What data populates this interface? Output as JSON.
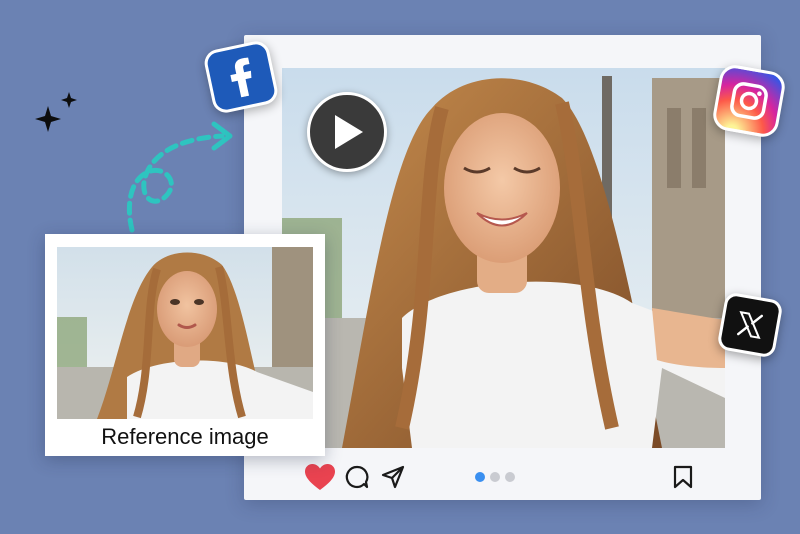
{
  "reference_card": {
    "caption": "Reference image"
  },
  "post": {
    "carousel_pages": 3,
    "active_page": 1,
    "liked": true
  },
  "icons": {
    "social": [
      "facebook-icon",
      "instagram-icon",
      "x-icon"
    ],
    "actions": [
      "heart-icon",
      "comment-icon",
      "share-icon",
      "bookmark-icon"
    ],
    "media": "play-icon",
    "decor": [
      "sparkle-icon",
      "curved-arrow-icon"
    ]
  },
  "colors": {
    "background": "#6b82b3",
    "like": "#e94350",
    "active_dot": "#3a8ff0",
    "arrow": "#2ec4c0",
    "facebook": "#1e5ab9"
  }
}
